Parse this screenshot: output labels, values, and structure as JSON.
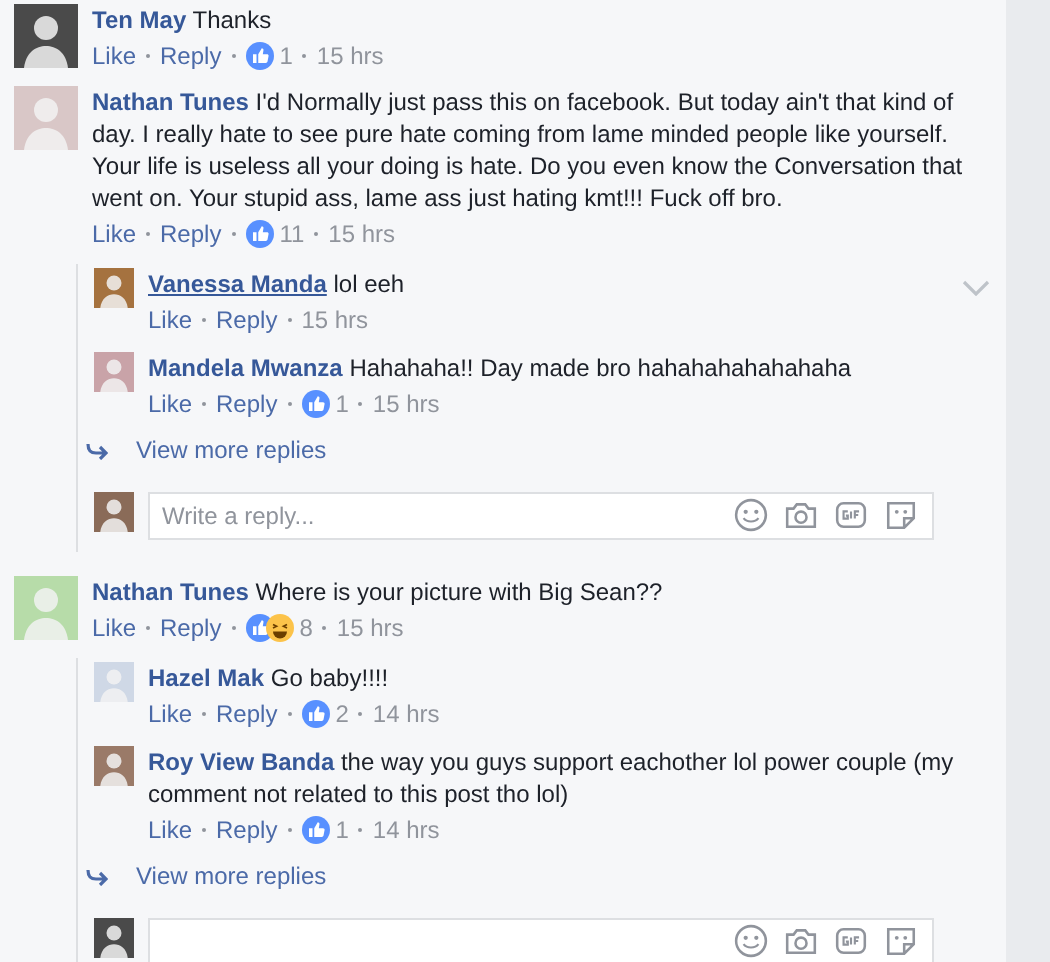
{
  "threads": [
    {
      "author": "Ten May",
      "text": "Thanks",
      "actions": [
        "Like",
        "Reply"
      ],
      "reactions": [
        {
          "kind": "like"
        }
      ],
      "count": "1",
      "time": "15 hrs"
    },
    {
      "author": "Nathan Tunes",
      "text": "I'd Normally just pass this on facebook. But today ain't that kind of day. I really hate to see pure hate coming from lame minded people like yourself. Your life is useless all your doing is hate. Do you even know the Conversation that went on. Your stupid ass, lame ass just hating kmt!!! Fuck off bro.",
      "actions": [
        "Like",
        "Reply"
      ],
      "reactions": [
        {
          "kind": "like"
        }
      ],
      "count": "11",
      "time": "15 hrs",
      "replies": [
        {
          "author": "Vanessa Manda",
          "hovered": true,
          "text": "lol eeh",
          "actions": [
            "Like",
            "Reply"
          ],
          "time": "15 hrs"
        },
        {
          "author": "Mandela Mwanza",
          "hovered": false,
          "text": "Hahahaha!! Day made bro hahahahahahahaha",
          "actions": [
            "Like",
            "Reply"
          ],
          "reactions": [
            {
              "kind": "like"
            }
          ],
          "count": "1",
          "time": "15 hrs"
        }
      ],
      "more_replies": "View more replies",
      "has_reply_box": true,
      "reply_placeholder": "Write a reply..."
    },
    {
      "author": "Nathan Tunes",
      "text": "Where is your picture with Big Sean??",
      "actions": [
        "Like",
        "Reply"
      ],
      "reactions": [
        {
          "kind": "like"
        },
        {
          "kind": "haha"
        }
      ],
      "count": "8",
      "time": "15 hrs",
      "replies": [
        {
          "author": "Hazel Mak",
          "hovered": false,
          "text": "Go baby!!!!",
          "actions": [
            "Like",
            "Reply"
          ],
          "reactions": [
            {
              "kind": "like"
            }
          ],
          "count": "2",
          "time": "14 hrs"
        },
        {
          "author": "Roy View Banda",
          "hovered": false,
          "text": "the way you guys support eachother lol power couple (my comment not related to this post tho lol)",
          "actions": [
            "Like",
            "Reply"
          ],
          "reactions": [
            {
              "kind": "like"
            }
          ],
          "count": "1",
          "time": "14 hrs"
        }
      ],
      "more_replies": "View more replies",
      "has_reply_box": true
    }
  ]
}
